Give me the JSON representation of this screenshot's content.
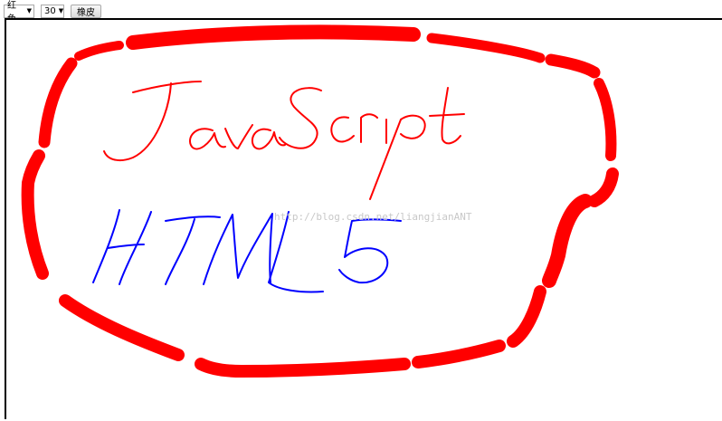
{
  "toolbar": {
    "color_select": {
      "value": "红色"
    },
    "size_select": {
      "value": "30"
    },
    "eraser_label": "橡皮"
  },
  "canvas": {
    "watermark": "http://blog.csdn.net/liangjianANT",
    "colors": {
      "red": "#ff0000",
      "blue": "#0000ff"
    }
  }
}
